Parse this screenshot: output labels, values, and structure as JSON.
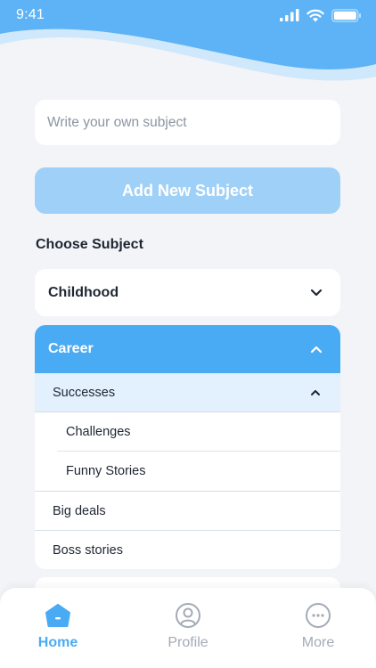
{
  "status_bar": {
    "time": "9:41"
  },
  "subject_input": {
    "placeholder": "Write your own subject",
    "value": ""
  },
  "add_button": {
    "label": "Add New Subject"
  },
  "section_title": "Choose Subject",
  "subjects": {
    "childhood": {
      "label": "Childhood",
      "expanded": false
    },
    "career": {
      "label": "Career",
      "expanded": true,
      "children": {
        "successes": {
          "label": "Successes",
          "expanded": true,
          "children": [
            "Challenges",
            "Funny Stories"
          ]
        },
        "items": [
          "Big deals",
          "Boss stories"
        ]
      }
    }
  },
  "nav": {
    "items": [
      {
        "label": "Home",
        "icon": "home-icon",
        "active": true
      },
      {
        "label": "Profile",
        "icon": "profile-icon",
        "active": false
      },
      {
        "label": "More",
        "icon": "more-icon",
        "active": false
      }
    ]
  },
  "colors": {
    "accent": "#4aabf5",
    "button_disabled": "#9fd0f7",
    "selected_row": "#e2f1fd",
    "background": "#f2f4f7",
    "text": "#1f2633",
    "muted": "#a3abb6"
  }
}
